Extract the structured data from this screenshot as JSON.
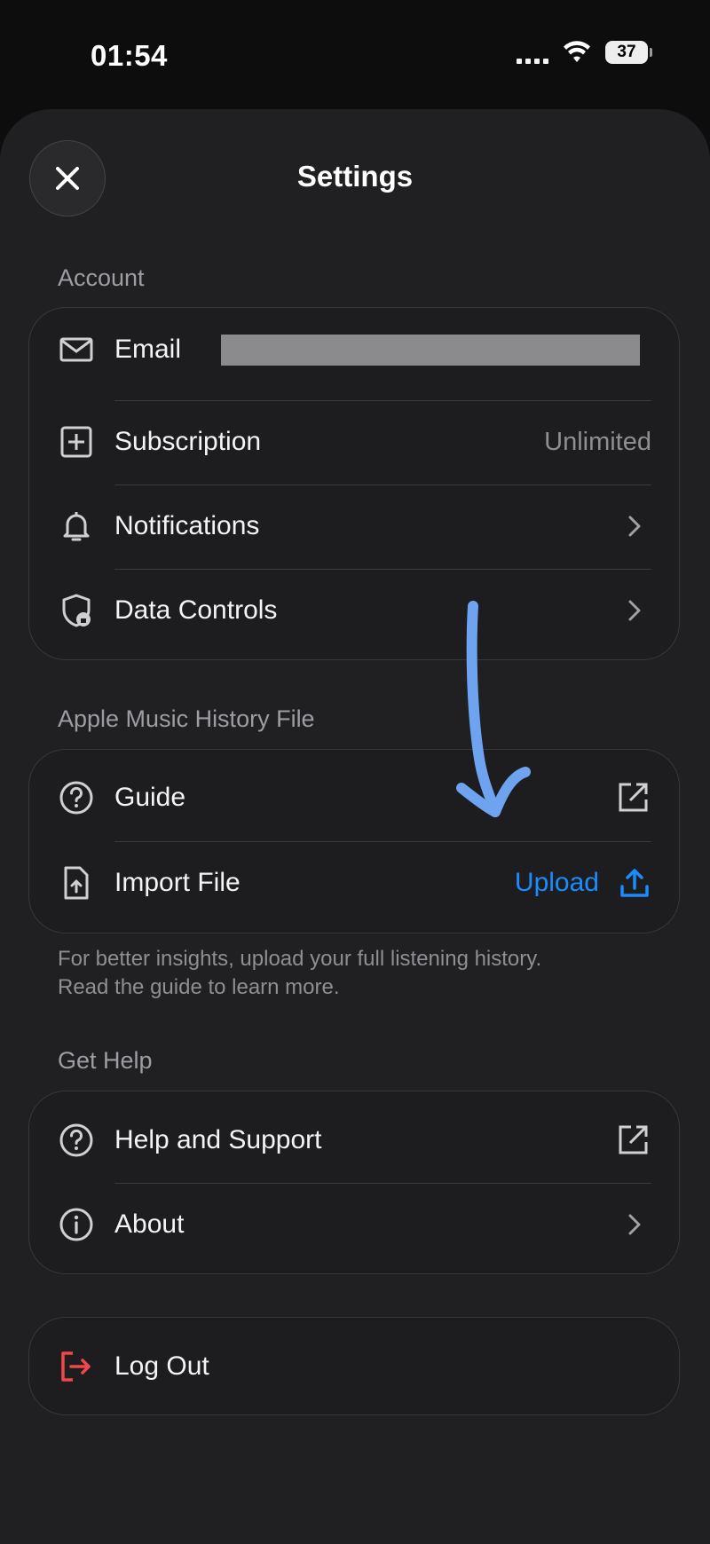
{
  "status_bar": {
    "time": "01:54",
    "battery": "37"
  },
  "header": {
    "title": "Settings"
  },
  "sections": {
    "account": {
      "label": "Account",
      "email_label": "Email",
      "subscription_label": "Subscription",
      "subscription_value": "Unlimited",
      "notifications_label": "Notifications",
      "data_controls_label": "Data Controls"
    },
    "history": {
      "label": "Apple Music History File",
      "guide_label": "Guide",
      "import_label": "Import File",
      "upload_label": "Upload",
      "footnote_line1": "For better insights, upload your full listening history.",
      "footnote_line2": "Read the guide to learn more."
    },
    "help": {
      "label": "Get Help",
      "support_label": "Help and Support",
      "about_label": "About"
    },
    "logout_label": "Log Out"
  },
  "colors": {
    "accent": "#1a8cff",
    "danger": "#f0474a",
    "annotation_arrow": "#6ea3f0"
  }
}
